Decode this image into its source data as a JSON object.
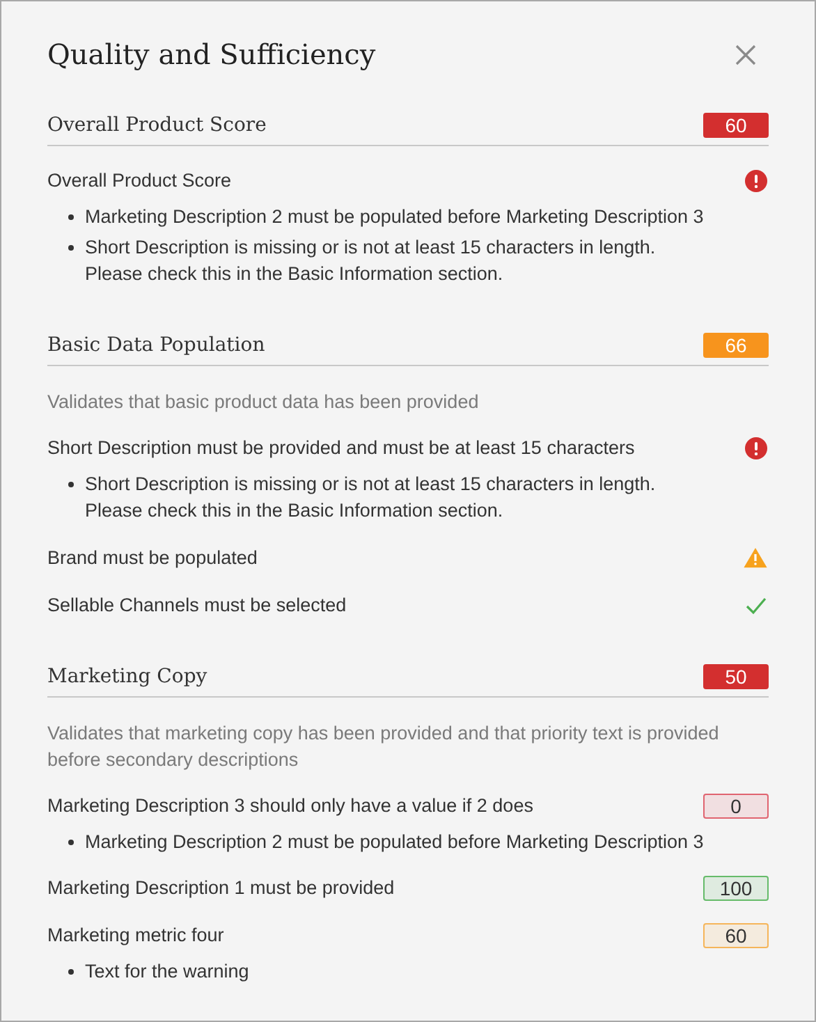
{
  "dialog": {
    "title": "Quality and Sufficiency"
  },
  "sections": [
    {
      "title": "Overall Product Score",
      "score": "60",
      "color": "#d32f2f",
      "rules": [
        {
          "kind": "error",
          "text": "Overall Product Score",
          "messages": [
            "Marketing Description 2 must be populated before Marketing Description 3",
            "Short Description is missing or is not at least 15 characters in length.\nPlease check this in the Basic Information section."
          ]
        }
      ]
    },
    {
      "title": "Basic Data Population",
      "score": "66",
      "color": "#f7941d",
      "description": "Validates that basic product data has been provided",
      "rules": [
        {
          "kind": "error",
          "text": "Short Description must be provided and must be at least 15 characters",
          "messages": [
            "Short Description is missing or is not at least 15 characters in length.\nPlease check this in the Basic Information section."
          ]
        },
        {
          "kind": "warning",
          "text": "Brand must be populated"
        },
        {
          "kind": "ok",
          "text": "Sellable Channels must be selected"
        }
      ]
    },
    {
      "title": "Marketing Copy",
      "score": "50",
      "color": "#d32f2f",
      "description": "Validates that marketing copy has been provided and that priority text is provided before secondary descriptions",
      "rules": [
        {
          "kind": "score",
          "text": "Marketing Description 3 should only have a value if 2 does",
          "color": "#e06470",
          "score": "0",
          "messages": [
            "Marketing Description 2 must be populated before Marketing Description 3"
          ]
        },
        {
          "kind": "score",
          "text": "Marketing Description 1 must be provided",
          "color": "#66bb6a",
          "score": "100"
        },
        {
          "kind": "score",
          "text": "Marketing metric four",
          "color": "#f5b55a",
          "score": "60",
          "messages": [
            "Text for the warning"
          ]
        }
      ]
    }
  ]
}
